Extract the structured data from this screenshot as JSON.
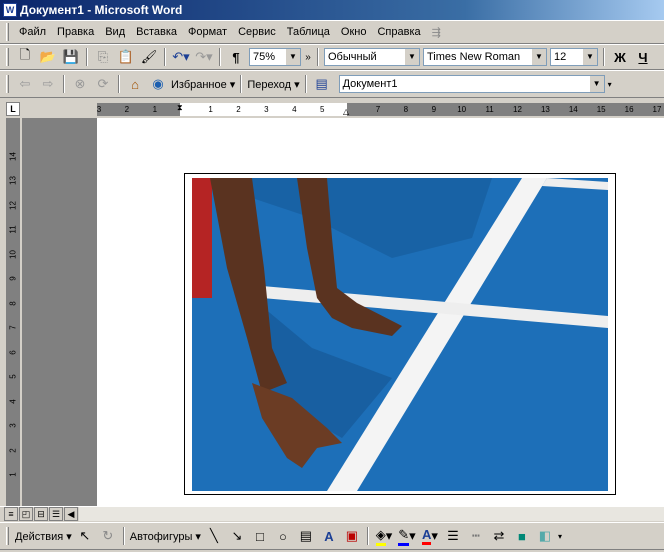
{
  "window": {
    "title": "Документ1 - Microsoft Word",
    "app_icon": "word-icon"
  },
  "menu": [
    "Файл",
    "Правка",
    "Вид",
    "Вставка",
    "Формат",
    "Сервис",
    "Таблица",
    "Окно",
    "Справка"
  ],
  "standard_toolbar": {
    "zoom": "75%",
    "style": "Обычный",
    "font": "Times New Roman",
    "size": "12",
    "bold": "Ж",
    "underline": "Ч",
    "pilcrow": "¶",
    "more": "»"
  },
  "web_toolbar": {
    "favorites": "Избранное",
    "go": "Переход",
    "address": "Документ1"
  },
  "ruler": {
    "tab_selector": "L",
    "labels": [
      "3",
      "2",
      "1",
      "",
      "1",
      "2",
      "3",
      "4",
      "5",
      "",
      "7",
      "8",
      "9",
      "10",
      "11",
      "12",
      "13",
      "14",
      "15",
      "16",
      "17"
    ],
    "vertical_labels": [
      "1",
      "2",
      "3",
      "4",
      "5",
      "6",
      "7",
      "8",
      "9",
      "10",
      "11",
      "12",
      "13",
      "14"
    ]
  },
  "drawing_toolbar": {
    "actions": "Действия",
    "autoshapes": "Автофигуры",
    "fill_color": "#ffff00",
    "line_color": "#0000ff",
    "font_color": "#ff0000",
    "font_color_glyph": "A"
  },
  "colors": {
    "title_bar": "#0a246a",
    "track_blue": "#1d6fb8"
  }
}
